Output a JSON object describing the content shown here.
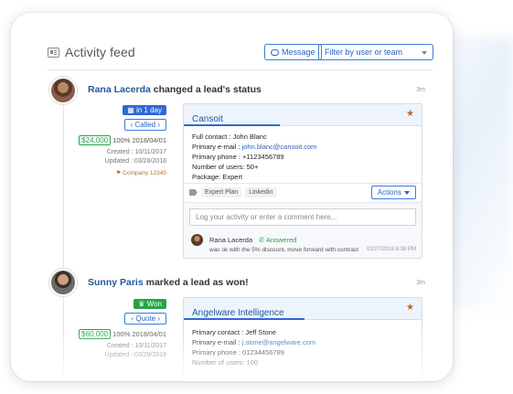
{
  "header": {
    "title": "Activity feed",
    "message_button": "Message",
    "filter_placeholder": "Filter by user or team"
  },
  "events": [
    {
      "user": "Rana Lacerda",
      "action": "changed a lead's status",
      "time": "3m",
      "status_badge": "in 1 day",
      "status_pill": "Called",
      "amount": "$24,000",
      "amount_rest": "100% 2018/04/01",
      "created": "Created : 10/11/2017",
      "updated": "Updated : 03/28/2018",
      "company": "Company 12345",
      "lead": {
        "name": "Cansoit",
        "details": {
          "full_contact": "Full contact : John Blanc",
          "primary_email_label": "Primary e-mail : ",
          "primary_email": "john.blanc@cansoit.com",
          "primary_phone": "Primary phone : +1123456789",
          "users": "Number of users: 50+",
          "package": "Package: Expert"
        },
        "tags": [
          "Expert Plan",
          "Linkedin"
        ],
        "actions_label": "Actions",
        "comment_placeholder": "Log your activity or enter a comment here...",
        "comment": {
          "author": "Rana Lacerda",
          "status": "Answered",
          "text": "was ok with the 5% discount, move forward with contract",
          "date": "03/27/2018 6:38 PM"
        }
      }
    },
    {
      "user": "Sunny Paris",
      "action": "marked a lead as won!",
      "time": "3m",
      "status_badge": "Won",
      "status_pill": "Quote",
      "amount": "$60,000",
      "amount_rest": "100% 2018/04/01",
      "created": "Created : 10/11/2017",
      "updated": "Updated : 03/28/2018",
      "lead": {
        "name": "Angelware Intelligence",
        "details": {
          "full_contact": "Primary contact : Jeff Stone",
          "primary_email_label": "Primary e-mail : ",
          "primary_email": "j.stone@angelware.com",
          "primary_phone": "Primary phone : 01234456789",
          "users": "Number of users: 100"
        }
      }
    }
  ],
  "colors": {
    "accent_blue": "#2f68d5",
    "link_blue": "#24579e",
    "success_green": "#27a447",
    "star_orange": "#b8692a"
  },
  "icons": [
    "activity-feed-icon",
    "chat-bubble-icon",
    "chevron-down-icon",
    "star-icon",
    "tag-icon",
    "phone-icon",
    "trophy-icon",
    "calendar-icon"
  ]
}
